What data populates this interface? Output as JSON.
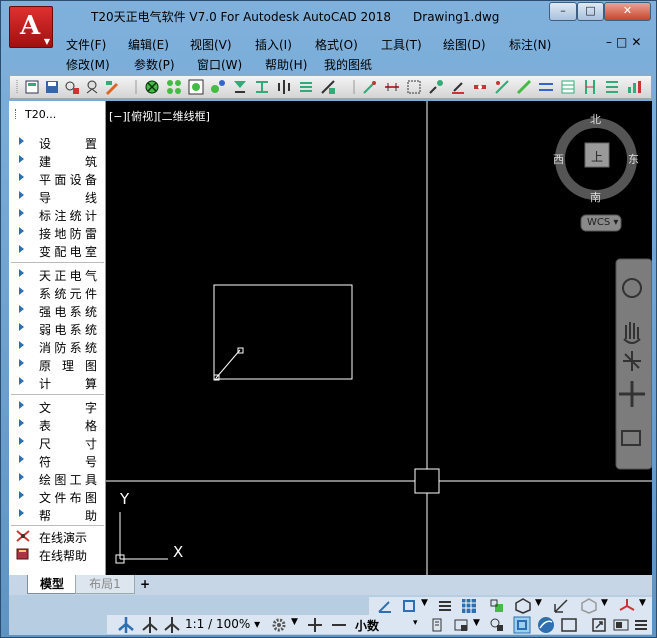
{
  "window": {
    "app_title": "T20天正电气软件 V7.0 For Autodesk AutoCAD 2018",
    "document_title": "Drawing1.dwg",
    "app_button_letter": "A",
    "min_glyph": "–",
    "max_glyph": "□",
    "close_glyph": "✕",
    "mdi_controls": "–□✕"
  },
  "menu_row1": [
    "文件(F)",
    "编辑(E)",
    "视图(V)",
    "插入(I)",
    "格式(O)",
    "工具(T)",
    "绘图(D)",
    "标注(N)"
  ],
  "menu_row2": [
    "修改(M)",
    "参数(P)",
    "窗口(W)",
    "帮助(H)",
    "我的图纸"
  ],
  "left_panel": {
    "title": "T20...",
    "group1": [
      "设置",
      "建筑",
      "平面设备",
      "导线",
      "标注统计",
      "接地防雷",
      "变配电室"
    ],
    "group2": [
      "天正电气",
      "系统元件",
      "强电系统",
      "弱电系统",
      "消防系统",
      "原理图",
      "计算"
    ],
    "group3": [
      "文字",
      "表格",
      "尺寸",
      "符号",
      "绘图工具",
      "文件布图",
      "帮助"
    ],
    "help_items": [
      "在线演示",
      "在线帮助"
    ]
  },
  "viewport": {
    "view_label": "[−][俯视][二维线框]",
    "compass": {
      "north": "北",
      "south": "南",
      "east": "东",
      "west": "西",
      "center": "上"
    },
    "wcs_label": "WCS ▾",
    "ucs_x": "X",
    "ucs_y": "Y"
  },
  "tabs": {
    "model": "模型",
    "layout1": "布局1",
    "add": "+"
  },
  "status": {
    "scale": "1:1 / 100% ▾",
    "units": "小数",
    "units_arrow": "▾"
  },
  "colors": {
    "accent_red": "#c81e1e",
    "canvas_bg": "#000000",
    "icon_blue": "#2d6fb0"
  }
}
